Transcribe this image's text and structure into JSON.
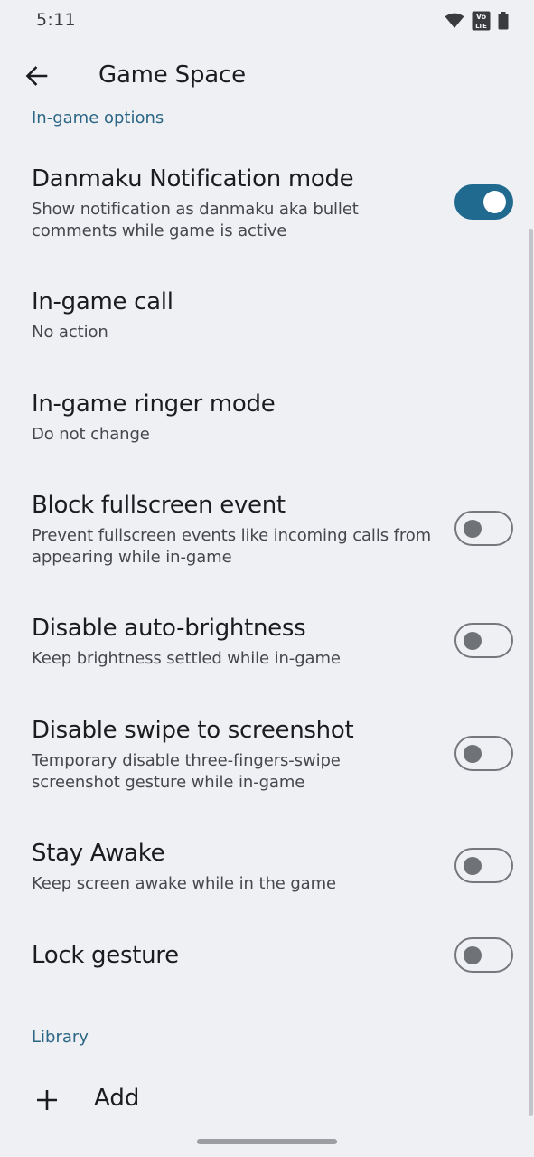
{
  "status_bar": {
    "time": "5:11",
    "icons": [
      "wifi-icon",
      "volte-icon",
      "battery-icon"
    ],
    "volte_text_top": "Vo",
    "volte_text_bottom": "LTE"
  },
  "app_bar": {
    "back_icon": "arrow-left-icon",
    "title": "Game Space"
  },
  "sections": {
    "in_game_options": "In-game options",
    "library": "Library"
  },
  "preferences": [
    {
      "key": "danmaku",
      "title": "Danmaku Notification mode",
      "summary": "Show notification as danmaku aka bullet comments while game is active",
      "switch": true
    },
    {
      "key": "call",
      "title": "In-game call",
      "summary": "No action"
    },
    {
      "key": "ringer",
      "title": "In-game ringer mode",
      "summary": "Do not change"
    },
    {
      "key": "fullscreen",
      "title": "Block fullscreen event",
      "summary": "Prevent fullscreen events like incoming calls from appearing while in-game",
      "switch": false
    },
    {
      "key": "brightness",
      "title": "Disable auto-brightness",
      "summary": "Keep brightness settled while in-game",
      "switch": false
    },
    {
      "key": "screenshot",
      "title": "Disable swipe to screenshot",
      "summary": "Temporary disable three-fingers-swipe screenshot gesture while in-game",
      "switch": false
    },
    {
      "key": "awake",
      "title": "Stay Awake",
      "summary": "Keep screen awake while in the game",
      "switch": false
    },
    {
      "key": "lock",
      "title": "Lock gesture",
      "switch": false
    }
  ],
  "library": {
    "add_icon": "plus-icon",
    "add_label": "Add"
  },
  "colors": {
    "accent": "#1f6a8e",
    "section_header": "#2b6685",
    "background": "#eff0f4"
  }
}
